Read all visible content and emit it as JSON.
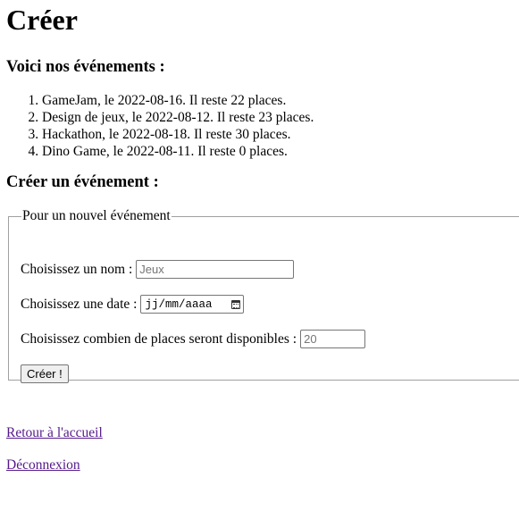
{
  "page": {
    "title": "Créer",
    "events_heading": "Voici nos événements :",
    "events": [
      "GameJam, le 2022-08-16. Il reste 22 places.",
      "Design de jeux, le 2022-08-12. Il reste 23 places.",
      "Hackathon, le 2022-08-18. Il reste 30 places.",
      "Dino Game, le 2022-08-11. Il reste 0 places."
    ],
    "create_heading": "Créer un événement :"
  },
  "form": {
    "legend": "Pour un nouvel événement",
    "name_label": "Choisissez un nom :",
    "name_placeholder": "Jeux",
    "date_label": "Choisissez une date :",
    "date_placeholder": "jj/mm/aaaa",
    "places_label": "Choisissez combien de places seront disponibles :",
    "places_placeholder": "20",
    "submit_label": "Créer !"
  },
  "links": {
    "home": "Retour à l'accueil",
    "logout": "Déconnexion"
  },
  "icons": {
    "date_picker": "calendar-icon"
  },
  "colors": {
    "visited_link": "#551a8b",
    "fieldset_border": "#a0a0a0"
  }
}
